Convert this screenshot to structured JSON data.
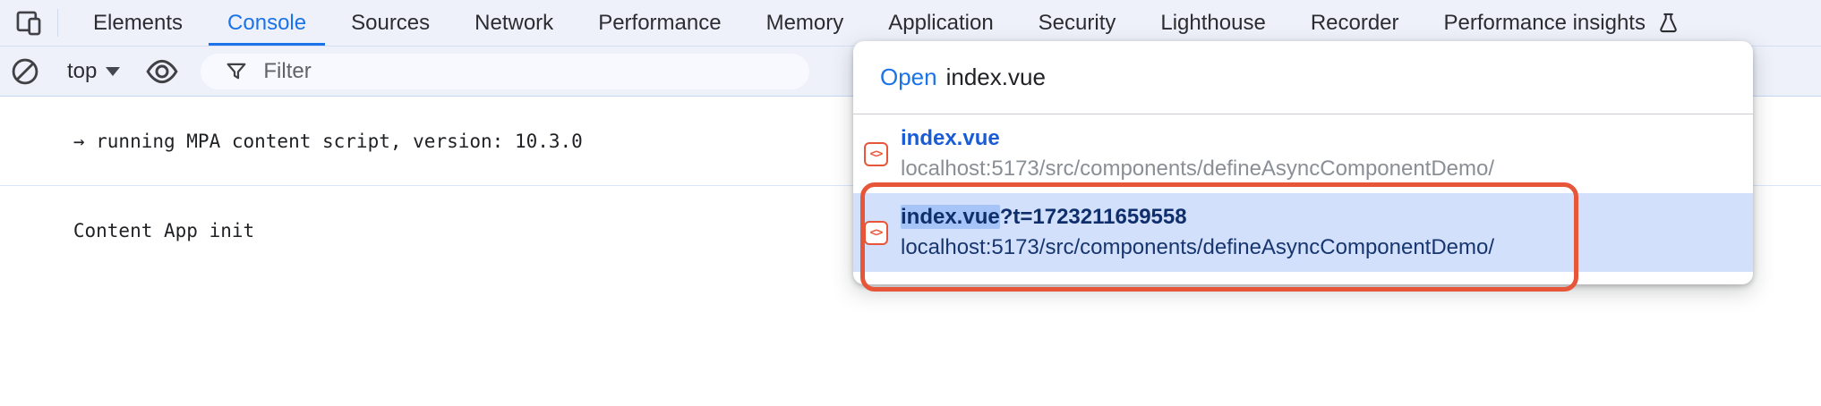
{
  "tabbar": {
    "tabs": [
      {
        "label": "Elements",
        "active": false
      },
      {
        "label": "Console",
        "active": true
      },
      {
        "label": "Sources",
        "active": false
      },
      {
        "label": "Network",
        "active": false
      },
      {
        "label": "Performance",
        "active": false
      },
      {
        "label": "Memory",
        "active": false
      },
      {
        "label": "Application",
        "active": false
      },
      {
        "label": "Security",
        "active": false
      },
      {
        "label": "Lighthouse",
        "active": false
      },
      {
        "label": "Recorder",
        "active": false
      },
      {
        "label": "Performance insights",
        "active": false,
        "icon": "flask-icon"
      }
    ],
    "left_icon": "toggle-device-toolbar-icon"
  },
  "toolbar": {
    "clear_icon": "block-clear-icon",
    "context_selector": {
      "value": "top",
      "caret_icon": "chevron-down-icon"
    },
    "eye_icon": "eye-icon",
    "filter": {
      "placeholder": "Filter",
      "icon": "funnel-filter-icon"
    }
  },
  "console": {
    "messages": [
      {
        "text": "→ running MPA content script, version: 10.3.0"
      },
      {
        "text": "Content App init"
      }
    ]
  },
  "quick_open": {
    "prefix": "Open",
    "query": "index.vue",
    "results": [
      {
        "title": "index.vue",
        "url": "localhost:5173/src/components/defineAsyncComponentDemo/",
        "icon": "vue-file-icon",
        "icon_glyph": "<>",
        "selected": false
      },
      {
        "title_match": "index.vue",
        "title_rest": "?t=1723211659558",
        "url": "localhost:5173/src/components/defineAsyncComponentDemo/",
        "icon": "vue-file-icon",
        "icon_glyph": "<>",
        "selected": true
      }
    ]
  },
  "colors": {
    "accent_blue": "#1a73e8",
    "chrome_bg": "#eef1fa",
    "selected_row_bg": "#d2e0fb",
    "selected_text_navy": "#0f2f6c",
    "match_highlight": "#a6c4f8",
    "orange_accent": "#e8563a",
    "result_title_blue": "#1a5cd6",
    "url_gray": "#8a8f96"
  }
}
